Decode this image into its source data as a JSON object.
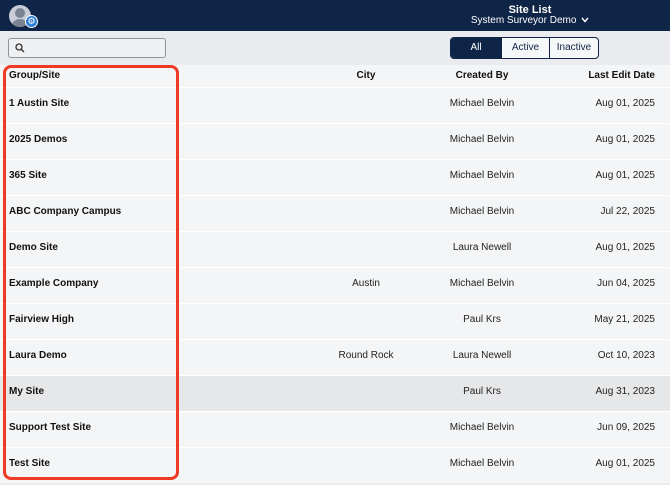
{
  "header": {
    "title": "Site List",
    "workspace": "System Surveyor Demo"
  },
  "toolbar": {
    "filters": [
      "All",
      "Active",
      "Inactive"
    ],
    "selected_filter": "All"
  },
  "table": {
    "columns": {
      "name": "Group/Site",
      "city": "City",
      "created_by": "Created By",
      "last_edit": "Last Edit Date"
    },
    "rows": [
      {
        "name": "1 Austin Site",
        "city": "",
        "created_by": "Michael Belvin",
        "date": "Aug 01, 2025"
      },
      {
        "name": "2025 Demos",
        "city": "",
        "created_by": "Michael Belvin",
        "date": "Aug 01, 2025"
      },
      {
        "name": "365 Site",
        "city": "",
        "created_by": "Michael Belvin",
        "date": "Aug 01, 2025"
      },
      {
        "name": "ABC Company Campus",
        "city": "",
        "created_by": "Michael Belvin",
        "date": "Jul 22, 2025"
      },
      {
        "name": "Demo Site",
        "city": "",
        "created_by": "Laura Newell",
        "date": "Aug 01, 2025"
      },
      {
        "name": "Example Company",
        "city": "Austin",
        "created_by": "Michael Belvin",
        "date": "Jun 04, 2025"
      },
      {
        "name": "Fairview High",
        "city": "",
        "created_by": "Paul Krs",
        "date": "May 21, 2025"
      },
      {
        "name": "Laura Demo",
        "city": "Round Rock",
        "created_by": "Laura Newell",
        "date": "Oct 10, 2023"
      },
      {
        "name": "My Site",
        "city": "",
        "created_by": "Paul Krs",
        "date": "Aug 31, 2023"
      },
      {
        "name": "Support Test Site",
        "city": "",
        "created_by": "Michael Belvin",
        "date": "Jun 09, 2025"
      },
      {
        "name": "Test Site",
        "city": "",
        "created_by": "Michael Belvin",
        "date": "Aug 01, 2025"
      }
    ]
  },
  "colors": {
    "navy": "#0f2547",
    "highlight": "#ef3b25"
  },
  "icons": [
    "user-avatar-icon",
    "gear-badge-icon",
    "chevron-down-icon",
    "search-icon"
  ]
}
